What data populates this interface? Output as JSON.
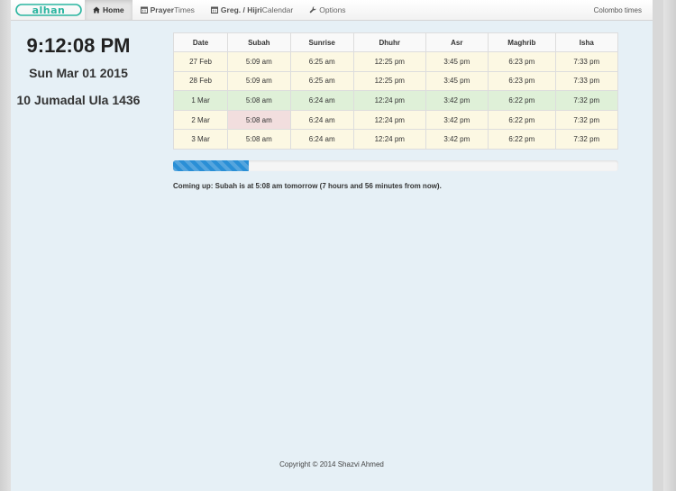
{
  "nav": {
    "brand": "alhan",
    "items": [
      {
        "bold": "",
        "text": "Home",
        "icon": "home-icon",
        "active": true
      },
      {
        "bold": "Prayer",
        "text": " Times",
        "icon": "calendar-icon",
        "active": false
      },
      {
        "bold": "Greg. / Hijri",
        "text": " Calendar",
        "icon": "calendar-icon",
        "active": false
      },
      {
        "bold": "",
        "text": "Options",
        "icon": "wrench-icon",
        "active": false
      }
    ],
    "location": "Colombo times"
  },
  "clock": {
    "time": "9:12:08 PM",
    "date": "Sun Mar 01 2015",
    "hijri": "10 Jumadal Ula 1436"
  },
  "table": {
    "headers": [
      "Date",
      "Subah",
      "Sunrise",
      "Dhuhr",
      "Asr",
      "Maghrib",
      "Isha"
    ],
    "rows": [
      [
        "27 Feb",
        "5:09 am",
        "6:25 am",
        "12:25 pm",
        "3:45 pm",
        "6:23 pm",
        "7:33 pm"
      ],
      [
        "28 Feb",
        "5:09 am",
        "6:25 am",
        "12:25 pm",
        "3:45 pm",
        "6:23 pm",
        "7:33 pm"
      ],
      [
        "1 Mar",
        "5:08 am",
        "6:24 am",
        "12:24 pm",
        "3:42 pm",
        "6:22 pm",
        "7:32 pm"
      ],
      [
        "2 Mar",
        "5:08 am",
        "6:24 am",
        "12:24 pm",
        "3:42 pm",
        "6:22 pm",
        "7:32 pm"
      ],
      [
        "3 Mar",
        "5:08 am",
        "6:24 am",
        "12:24 pm",
        "3:42 pm",
        "6:22 pm",
        "7:32 pm"
      ]
    ],
    "today_row": 2,
    "next_prayer_cell": {
      "row": 3,
      "col": 1
    }
  },
  "progress": {
    "percent": 17,
    "color": "#2a8fd6"
  },
  "coming_up": "Coming up: Subah is at 5:08 am tomorrow (7 hours and 56 minutes from now).",
  "footer": "Copyright © 2014 Shazvi Ahmed",
  "colors": {
    "today_row": "#dff0d8",
    "upcoming_cell": "#f2dede",
    "row_default": "#fcf8e3",
    "brand": "#2bb5a0"
  }
}
